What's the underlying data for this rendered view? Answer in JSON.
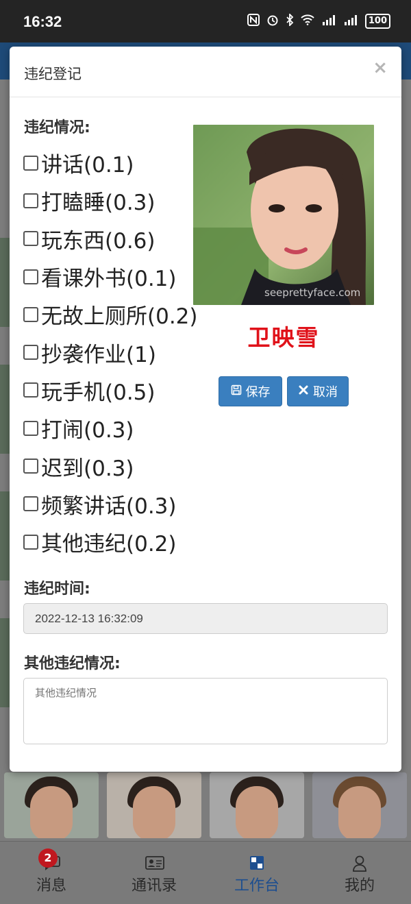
{
  "status_bar": {
    "time": "16:32",
    "icons": [
      "nfc-icon",
      "alarm-icon",
      "bluetooth-icon",
      "wifi-icon",
      "signal-4g-icon",
      "signal-4g-icon"
    ],
    "battery": "100"
  },
  "modal": {
    "title": "违纪登记",
    "close": "×",
    "violations_label": "违纪情况:",
    "violations": [
      {
        "label": "讲话(0.1)",
        "checked": false
      },
      {
        "label": "打瞌睡(0.3)",
        "checked": false
      },
      {
        "label": "玩东西(0.6)",
        "checked": false
      },
      {
        "label": "看课外书(0.1)",
        "checked": false
      },
      {
        "label": "无故上厕所(0.2)",
        "checked": false
      },
      {
        "label": "抄袭作业(1)",
        "checked": false
      },
      {
        "label": "玩手机(0.5)",
        "checked": false
      },
      {
        "label": "打闹(0.3)",
        "checked": false
      },
      {
        "label": "迟到(0.3)",
        "checked": false
      },
      {
        "label": "频繁讲话(0.3)",
        "checked": false
      },
      {
        "label": "其他违纪(0.2)",
        "checked": false
      }
    ],
    "photo_watermark": "seeprettyface.com",
    "student_name": "卫映雪",
    "save_label": "保存",
    "cancel_label": "取消",
    "time_label": "违纪时间:",
    "time_value": "2022-12-13 16:32:09",
    "other_label": "其他违纪情况:",
    "other_placeholder": "其他违纪情况"
  },
  "bottom_nav": {
    "items": [
      {
        "label": "消息",
        "icon": "chat-icon",
        "badge": "2"
      },
      {
        "label": "通讯录",
        "icon": "contacts-icon"
      },
      {
        "label": "工作台",
        "icon": "workbench-icon",
        "active": true
      },
      {
        "label": "我的",
        "icon": "user-icon"
      }
    ]
  },
  "colors": {
    "accent": "#3a7fbf",
    "name_red": "#e0121a",
    "badge_red": "#c0181f",
    "active_nav": "#1d4e8f"
  }
}
